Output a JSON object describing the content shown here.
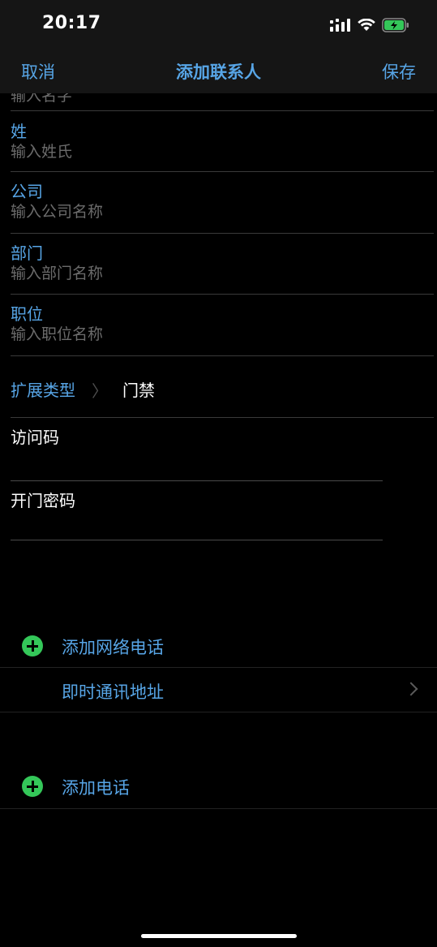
{
  "status_bar": {
    "time": "20:17",
    "signal_icon": "cellular-signal-icon",
    "wifi_icon": "wifi-icon",
    "battery_icon": "battery-charging-icon",
    "battery_color": "#34c759"
  },
  "nav": {
    "cancel_label": "取消",
    "title": "添加联系人",
    "save_label": "保存"
  },
  "form": {
    "clipped_placeholder": "输入名字",
    "last_name": {
      "label": "姓",
      "placeholder": "输入姓氏"
    },
    "company": {
      "label": "公司",
      "placeholder": "输入公司名称"
    },
    "department": {
      "label": "部门",
      "placeholder": "输入部门名称"
    },
    "position": {
      "label": "职位",
      "placeholder": "输入职位名称"
    },
    "extension": {
      "label": "扩展类型",
      "chevron": "〉",
      "value": "门禁"
    },
    "access_code_label": "访问码",
    "door_password_label": "开门密码"
  },
  "actions": {
    "add_network_phone": "添加网络电话",
    "im_address": "即时通讯地址",
    "add_phone": "添加电话"
  },
  "colors": {
    "accent": "#57a5e6",
    "add_icon": "#34c759",
    "background": "#000000"
  }
}
